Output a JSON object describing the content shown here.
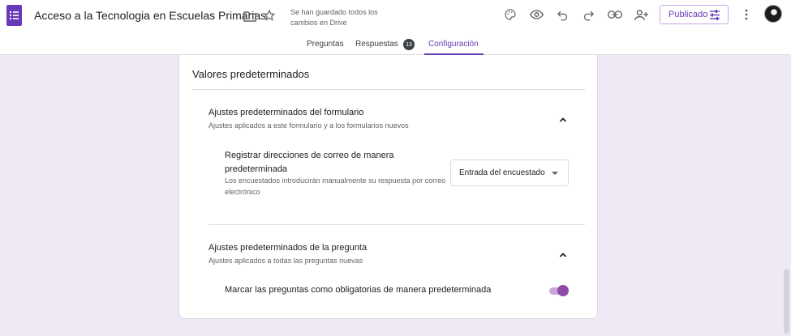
{
  "header": {
    "title": "Acceso a la Tecnologia en Escuelas Primarias",
    "save_status": "Se han guardado todos los cambios en Drive",
    "publish_label": "Publicado",
    "icons": [
      "forms-logo-icon",
      "folder-icon",
      "star-icon",
      "palette-icon",
      "preview-eye-icon",
      "undo-icon",
      "redo-icon",
      "link-icon",
      "add-collaborator-icon",
      "tune-icon",
      "more-vert-icon",
      "avatar"
    ],
    "accent_color": "#673ab7"
  },
  "tabs": [
    {
      "label": "Preguntas"
    },
    {
      "label": "Respuestas",
      "badge": "13"
    },
    {
      "label": "Configuración",
      "active": true
    }
  ],
  "card": {
    "title": "Valores predeterminados",
    "form_defaults": {
      "title": "Ajustes predeterminados del formulario",
      "subtitle": "Ajustes aplicados a este formulario y a los formularios nuevos",
      "email_setting": {
        "label": "Registrar direcciones de correo de manera predeterminada",
        "description": "Los encuestados introducirán manualmente su respuesta por correo electrónico",
        "selected": "Entrada del encuestado"
      }
    },
    "question_defaults": {
      "title": "Ajustes predeterminados de la pregunta",
      "subtitle": "Ajustes aplicados a todas las preguntas nuevas",
      "required_setting": {
        "label": "Marcar las preguntas como obligatorias de manera predeterminada",
        "enabled": true
      }
    }
  }
}
